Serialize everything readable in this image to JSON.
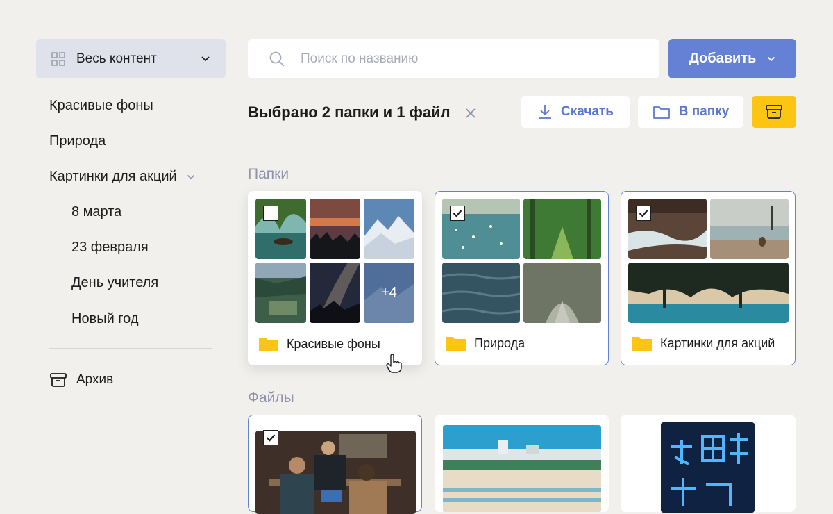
{
  "sidebar": {
    "content_filter": {
      "label": "Весь контент",
      "icon": "grid-icon"
    },
    "items": [
      {
        "label": "Красивые фоны"
      },
      {
        "label": "Природа"
      },
      {
        "label": "Картинки для акций",
        "expanded": true,
        "children": [
          {
            "label": "8 марта"
          },
          {
            "label": "23 февраля"
          },
          {
            "label": "День учителя"
          },
          {
            "label": "Новый год"
          }
        ]
      }
    ],
    "archive": {
      "label": "Архив",
      "icon": "archive-box-icon"
    }
  },
  "search": {
    "placeholder": "Поиск по названию",
    "value": ""
  },
  "add_button": {
    "label": "Добавить"
  },
  "selection": {
    "title": "Выбрано 2 папки и 1 файл",
    "download_label": "Скачать",
    "to_folder_label": "В папку"
  },
  "sections": {
    "folders": "Папки",
    "files": "Файлы"
  },
  "folders": [
    {
      "name": "Красивые фоны",
      "selected": false,
      "more_count": "+4"
    },
    {
      "name": "Природа",
      "selected": true
    },
    {
      "name": "Картинки для акций",
      "selected": true
    }
  ],
  "files": [
    {
      "selected": true
    },
    {
      "selected": false
    },
    {
      "selected": false
    }
  ],
  "colors": {
    "accent": "#6481d6",
    "accent_text": "#5b78d0",
    "archive_button": "#fcc514",
    "folder_icon": "#fcc514",
    "background": "#f1f0ec",
    "section_heading": "#8a93a9"
  }
}
